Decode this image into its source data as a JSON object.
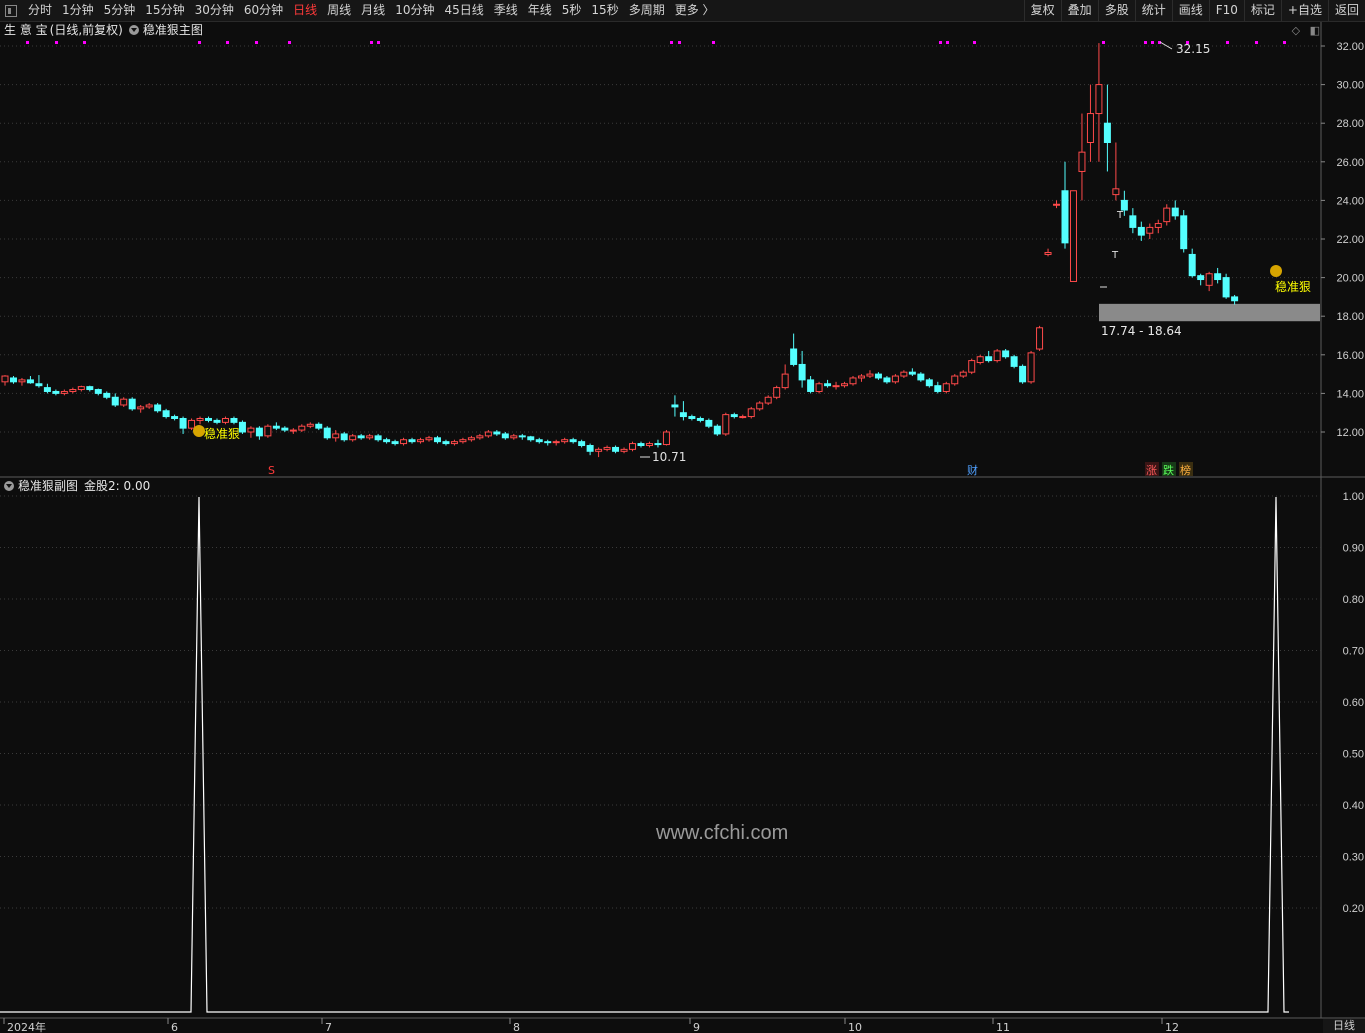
{
  "toolbar": {
    "periods": [
      "分时",
      "1分钟",
      "5分钟",
      "15分钟",
      "30分钟",
      "60分钟",
      "日线",
      "周线",
      "月线",
      "10分钟",
      "45日线",
      "季线",
      "年线",
      "5秒",
      "15秒",
      "多周期",
      "更多 〉"
    ],
    "active_period": "日线",
    "right_buttons": [
      "复权",
      "叠加",
      "多股",
      "统计",
      "画线",
      "F10",
      "标记",
      "+自选",
      "返回"
    ]
  },
  "main_chart": {
    "stock_name": "生 意 宝",
    "mode": "(日线,前复权)",
    "indicator": "稳准狠主图",
    "price_ticks": [
      "32.00",
      "30.00",
      "28.00",
      "26.00",
      "24.00",
      "22.00",
      "20.00",
      "18.00",
      "16.00",
      "14.00",
      "12.00"
    ],
    "high_label": "32.15",
    "low_label": "10.71",
    "zone_label": "17.74 - 18.64",
    "signal_text": "稳准狠",
    "markers": {
      "s": "S",
      "cai": "财",
      "zhang": "涨",
      "die": "跌",
      "bang": "榜"
    },
    "t_marks": [
      "T",
      "T"
    ]
  },
  "sub_chart": {
    "indicator": "稳准狠副图",
    "value_label": "金股2: 0.00",
    "ticks": [
      "1.00",
      "0.90",
      "0.80",
      "0.70",
      "0.60",
      "0.50",
      "0.40",
      "0.30",
      "0.20"
    ]
  },
  "x_axis": [
    "2024年",
    "6",
    "7",
    "8",
    "9",
    "10",
    "11",
    "12"
  ],
  "watermark": "www.cfchi.com",
  "bottom_right": "日线",
  "colors": {
    "up": "#ff4a4a",
    "down": "#54ffff",
    "highlight": "#ffff00",
    "magenta": "#ff00ff",
    "zone": "#8a8a8a"
  },
  "chart_data": {
    "type": "candlestick",
    "ylim": [
      10.0,
      32.5
    ],
    "candles": [
      [
        14.6,
        14.95,
        14.4,
        14.9
      ],
      [
        14.8,
        14.9,
        14.5,
        14.6
      ],
      [
        14.6,
        14.8,
        14.4,
        14.7
      ],
      [
        14.7,
        14.9,
        14.5,
        14.55
      ],
      [
        14.5,
        14.95,
        14.3,
        14.4
      ],
      [
        14.3,
        14.5,
        14.0,
        14.1
      ],
      [
        14.1,
        14.2,
        13.9,
        14.0
      ],
      [
        14.0,
        14.2,
        13.9,
        14.1
      ],
      [
        14.1,
        14.3,
        14.0,
        14.2
      ],
      [
        14.2,
        14.4,
        14.1,
        14.35
      ],
      [
        14.35,
        14.4,
        14.1,
        14.2
      ],
      [
        14.2,
        14.25,
        13.9,
        14.0
      ],
      [
        14.0,
        14.1,
        13.7,
        13.8
      ],
      [
        13.8,
        14.0,
        13.3,
        13.4
      ],
      [
        13.4,
        13.8,
        13.3,
        13.7
      ],
      [
        13.7,
        13.8,
        13.1,
        13.2
      ],
      [
        13.2,
        13.4,
        13.0,
        13.3
      ],
      [
        13.3,
        13.5,
        13.2,
        13.4
      ],
      [
        13.4,
        13.5,
        13.0,
        13.1
      ],
      [
        13.1,
        13.2,
        12.7,
        12.8
      ],
      [
        12.8,
        12.9,
        12.6,
        12.7
      ],
      [
        12.7,
        12.8,
        11.9,
        12.2
      ],
      [
        12.2,
        12.7,
        12.1,
        12.6
      ],
      [
        12.6,
        12.8,
        12.4,
        12.7
      ],
      [
        12.7,
        12.8,
        12.5,
        12.6
      ],
      [
        12.6,
        12.7,
        12.4,
        12.5
      ],
      [
        12.5,
        12.8,
        12.4,
        12.7
      ],
      [
        12.7,
        12.8,
        12.4,
        12.5
      ],
      [
        12.5,
        12.6,
        11.9,
        12.0
      ],
      [
        12.0,
        12.3,
        11.7,
        12.2
      ],
      [
        12.2,
        12.3,
        11.6,
        11.8
      ],
      [
        11.8,
        12.4,
        11.7,
        12.3
      ],
      [
        12.3,
        12.5,
        12.1,
        12.2
      ],
      [
        12.2,
        12.3,
        12.0,
        12.1
      ],
      [
        12.1,
        12.2,
        11.9,
        12.1
      ],
      [
        12.1,
        12.4,
        12.0,
        12.3
      ],
      [
        12.3,
        12.5,
        12.2,
        12.4
      ],
      [
        12.4,
        12.5,
        12.1,
        12.2
      ],
      [
        12.2,
        12.3,
        11.6,
        11.7
      ],
      [
        11.7,
        12.1,
        11.5,
        11.9
      ],
      [
        11.9,
        12.0,
        11.5,
        11.6
      ],
      [
        11.6,
        11.9,
        11.5,
        11.8
      ],
      [
        11.8,
        11.9,
        11.6,
        11.7
      ],
      [
        11.7,
        11.9,
        11.6,
        11.8
      ],
      [
        11.8,
        11.9,
        11.5,
        11.6
      ],
      [
        11.6,
        11.7,
        11.4,
        11.5
      ],
      [
        11.5,
        11.6,
        11.3,
        11.4
      ],
      [
        11.4,
        11.7,
        11.3,
        11.6
      ],
      [
        11.6,
        11.7,
        11.4,
        11.5
      ],
      [
        11.5,
        11.7,
        11.4,
        11.6
      ],
      [
        11.6,
        11.8,
        11.5,
        11.7
      ],
      [
        11.7,
        11.8,
        11.4,
        11.5
      ],
      [
        11.5,
        11.6,
        11.3,
        11.4
      ],
      [
        11.4,
        11.6,
        11.3,
        11.5
      ],
      [
        11.5,
        11.7,
        11.4,
        11.6
      ],
      [
        11.6,
        11.8,
        11.5,
        11.7
      ],
      [
        11.7,
        11.9,
        11.6,
        11.8
      ],
      [
        11.8,
        12.1,
        11.7,
        12.0
      ],
      [
        12.0,
        12.1,
        11.8,
        11.9
      ],
      [
        11.9,
        12.0,
        11.6,
        11.7
      ],
      [
        11.7,
        11.9,
        11.6,
        11.8
      ],
      [
        11.8,
        11.9,
        11.6,
        11.75
      ],
      [
        11.75,
        11.8,
        11.5,
        11.6
      ],
      [
        11.6,
        11.7,
        11.4,
        11.5
      ],
      [
        11.5,
        11.6,
        11.3,
        11.45
      ],
      [
        11.45,
        11.6,
        11.3,
        11.5
      ],
      [
        11.5,
        11.7,
        11.4,
        11.6
      ],
      [
        11.6,
        11.7,
        11.4,
        11.5
      ],
      [
        11.5,
        11.6,
        11.2,
        11.3
      ],
      [
        11.3,
        11.4,
        10.8,
        11.0
      ],
      [
        11.0,
        11.2,
        10.7,
        11.1
      ],
      [
        11.1,
        11.3,
        11.0,
        11.2
      ],
      [
        11.2,
        11.3,
        10.9,
        11.0
      ],
      [
        11.0,
        11.2,
        10.9,
        11.1
      ],
      [
        11.1,
        11.5,
        11.0,
        11.4
      ],
      [
        11.4,
        11.5,
        11.2,
        11.3
      ],
      [
        11.3,
        11.5,
        11.2,
        11.4
      ],
      [
        11.4,
        11.6,
        11.2,
        11.35
      ],
      [
        11.35,
        12.1,
        11.3,
        12.0
      ],
      [
        13.4,
        13.9,
        12.8,
        13.3
      ],
      [
        13.0,
        13.6,
        12.6,
        12.8
      ],
      [
        12.8,
        12.9,
        12.6,
        12.7
      ],
      [
        12.7,
        12.8,
        12.5,
        12.6
      ],
      [
        12.6,
        12.7,
        12.2,
        12.3
      ],
      [
        12.3,
        12.4,
        11.8,
        11.9
      ],
      [
        11.9,
        13.0,
        11.8,
        12.9
      ],
      [
        12.9,
        13.0,
        12.7,
        12.8
      ],
      [
        12.8,
        12.9,
        12.7,
        12.8
      ],
      [
        12.8,
        13.3,
        12.7,
        13.2
      ],
      [
        13.2,
        13.6,
        13.1,
        13.5
      ],
      [
        13.5,
        13.9,
        13.4,
        13.8
      ],
      [
        13.8,
        14.4,
        13.7,
        14.3
      ],
      [
        14.3,
        15.5,
        14.2,
        15.0
      ],
      [
        16.3,
        17.1,
        15.4,
        15.5
      ],
      [
        15.5,
        16.2,
        14.3,
        14.7
      ],
      [
        14.7,
        14.9,
        14.0,
        14.1
      ],
      [
        14.1,
        14.6,
        14.0,
        14.5
      ],
      [
        14.5,
        14.7,
        14.3,
        14.4
      ],
      [
        14.4,
        14.6,
        14.2,
        14.4
      ],
      [
        14.4,
        14.6,
        14.3,
        14.5
      ],
      [
        14.5,
        14.9,
        14.4,
        14.8
      ],
      [
        14.8,
        15.0,
        14.6,
        14.9
      ],
      [
        14.9,
        15.2,
        14.8,
        15.0
      ],
      [
        15.0,
        15.1,
        14.7,
        14.8
      ],
      [
        14.8,
        14.9,
        14.5,
        14.6
      ],
      [
        14.6,
        15.0,
        14.5,
        14.9
      ],
      [
        14.9,
        15.2,
        14.8,
        15.1
      ],
      [
        15.1,
        15.3,
        14.9,
        15.0
      ],
      [
        15.0,
        15.1,
        14.6,
        14.7
      ],
      [
        14.7,
        14.8,
        14.3,
        14.4
      ],
      [
        14.4,
        14.6,
        14.0,
        14.1
      ],
      [
        14.1,
        14.6,
        14.0,
        14.5
      ],
      [
        14.5,
        15.0,
        14.4,
        14.9
      ],
      [
        14.9,
        15.2,
        14.8,
        15.1
      ],
      [
        15.1,
        15.8,
        15.0,
        15.7
      ],
      [
        15.6,
        16.0,
        15.5,
        15.9
      ],
      [
        15.9,
        16.2,
        15.6,
        15.7
      ],
      [
        15.7,
        16.3,
        15.6,
        16.2
      ],
      [
        16.2,
        16.3,
        15.8,
        15.9
      ],
      [
        15.9,
        16.0,
        15.3,
        15.4
      ],
      [
        15.4,
        15.5,
        14.5,
        14.6
      ],
      [
        14.6,
        16.2,
        14.5,
        16.1
      ],
      [
        16.3,
        17.5,
        16.2,
        17.4
      ],
      [
        21.2,
        21.5,
        21.1,
        21.3
      ],
      [
        23.8,
        24.0,
        23.6,
        23.8
      ],
      [
        24.5,
        26.0,
        21.5,
        21.8
      ],
      [
        19.8,
        24.5,
        19.8,
        24.5
      ],
      [
        25.5,
        28.5,
        24.0,
        26.5
      ],
      [
        27.0,
        30.0,
        26.0,
        28.5
      ],
      [
        28.5,
        32.15,
        26.0,
        30.0
      ],
      [
        28.0,
        30.0,
        25.5,
        27.0
      ],
      [
        24.3,
        27.0,
        24.0,
        24.6
      ],
      [
        24.0,
        24.5,
        23.2,
        23.5
      ],
      [
        23.2,
        23.6,
        22.3,
        22.6
      ],
      [
        22.6,
        22.9,
        21.9,
        22.2
      ],
      [
        22.3,
        22.8,
        22.0,
        22.6
      ],
      [
        22.6,
        23.0,
        22.3,
        22.8
      ],
      [
        22.9,
        23.8,
        22.7,
        23.6
      ],
      [
        23.6,
        24.0,
        23.0,
        23.2
      ],
      [
        23.2,
        23.5,
        21.3,
        21.5
      ],
      [
        21.2,
        21.5,
        20.0,
        20.1
      ],
      [
        20.1,
        20.2,
        19.6,
        19.9
      ],
      [
        19.6,
        20.3,
        19.3,
        20.2
      ],
      [
        20.2,
        20.5,
        19.7,
        19.9
      ],
      [
        20.0,
        20.2,
        18.9,
        19.0
      ],
      [
        19.0,
        19.1,
        18.6,
        18.8
      ]
    ],
    "zone": [
      17.74,
      18.64
    ],
    "sub_spikes": [
      [
        6,
        1.0
      ],
      [
        12,
        1.0
      ]
    ]
  }
}
